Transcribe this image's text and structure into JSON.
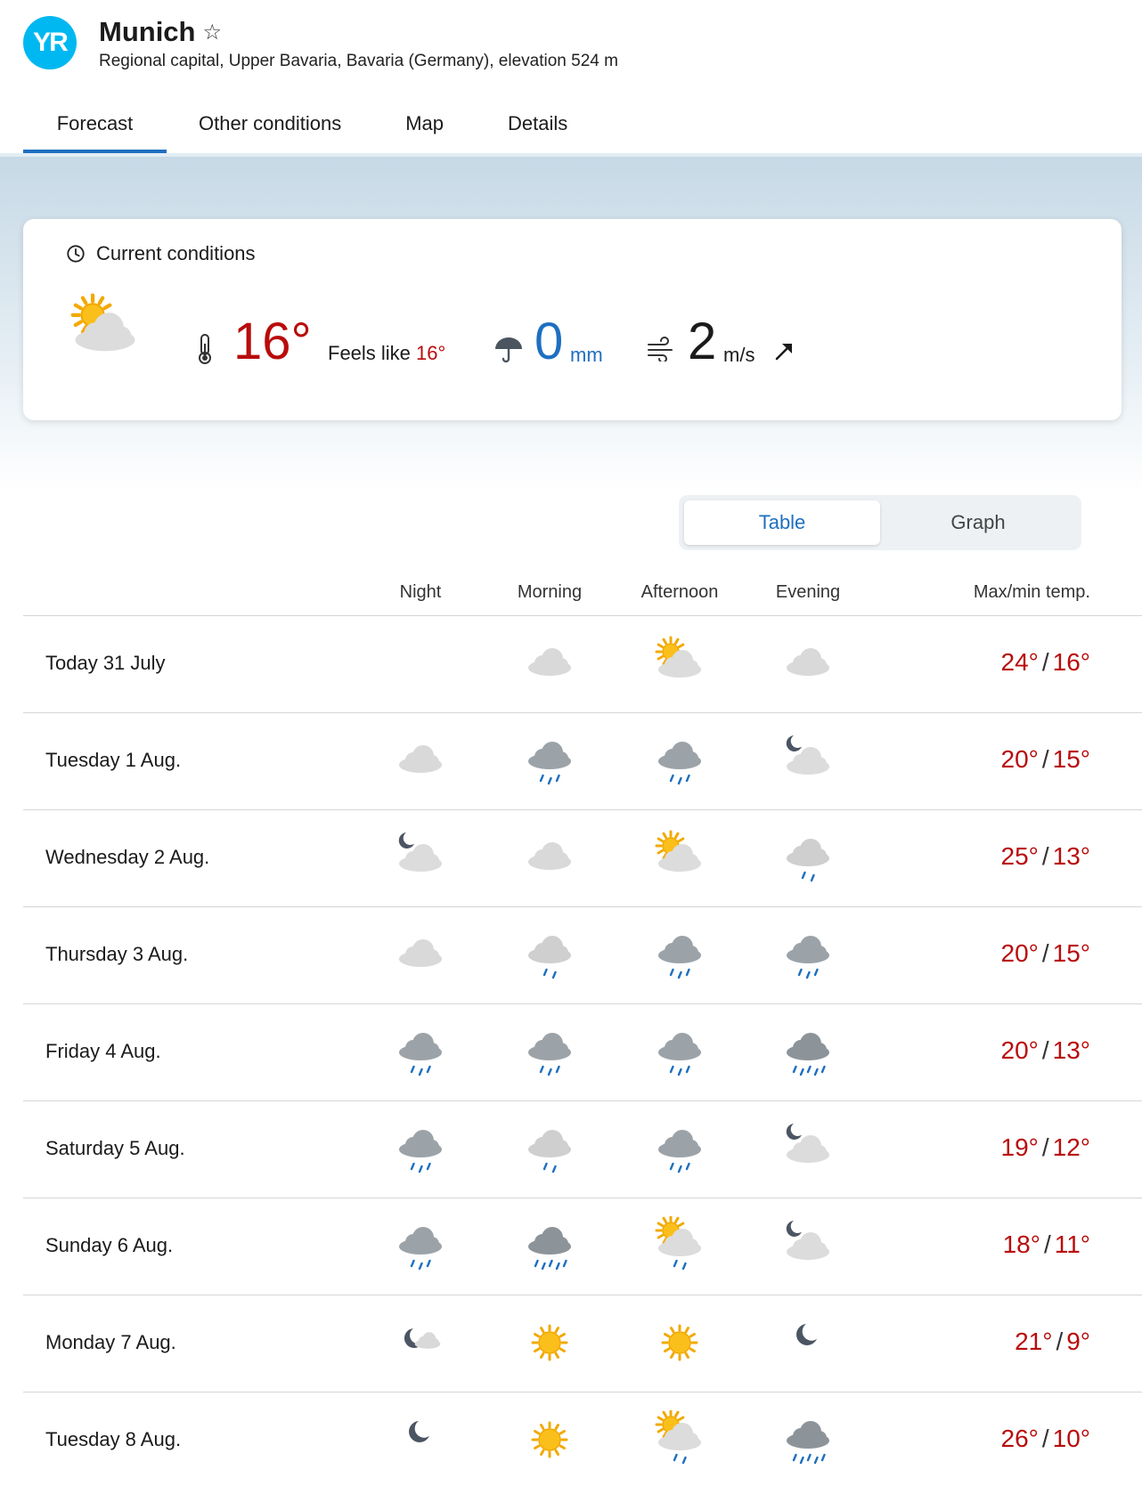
{
  "header": {
    "logo_text": "YR",
    "title": "Munich",
    "subtitle": "Regional capital, Upper Bavaria, Bavaria (Germany), elevation 524 m"
  },
  "tabs": [
    {
      "label": "Forecast",
      "active": true
    },
    {
      "label": "Other conditions",
      "active": false
    },
    {
      "label": "Map",
      "active": false
    },
    {
      "label": "Details",
      "active": false
    }
  ],
  "current": {
    "label": "Current conditions",
    "icon": "partly-cloudy-day",
    "temp": "16°",
    "feels_label": "Feels like",
    "feels_value": "16°",
    "precip_value": "0",
    "precip_unit": "mm",
    "wind_value": "2",
    "wind_unit": "m/s"
  },
  "view_toggle": {
    "table": "Table",
    "graph": "Graph",
    "selected": "Table"
  },
  "columns": {
    "night": "Night",
    "morning": "Morning",
    "afternoon": "Afternoon",
    "evening": "Evening",
    "maxmin": "Max/min temp."
  },
  "colors": {
    "accent": "#1e6fc0",
    "temp": "#b90c0c",
    "logo": "#00b8f1"
  },
  "days": [
    {
      "label": "Today 31 July",
      "night": "",
      "morning": "cloudy",
      "afternoon": "partly-cloudy-day",
      "evening": "cloudy",
      "max": "24°",
      "min": "16°"
    },
    {
      "label": "Tuesday 1 Aug.",
      "night": "cloudy",
      "morning": "rain",
      "afternoon": "rain",
      "evening": "partly-cloudy-night",
      "max": "20°",
      "min": "15°"
    },
    {
      "label": "Wednesday 2 Aug.",
      "night": "partly-cloudy-night",
      "morning": "cloudy",
      "afternoon": "partly-cloudy-day",
      "evening": "light-rain",
      "max": "25°",
      "min": "13°"
    },
    {
      "label": "Thursday 3 Aug.",
      "night": "cloudy",
      "morning": "light-rain",
      "afternoon": "rain",
      "evening": "rain",
      "max": "20°",
      "min": "15°"
    },
    {
      "label": "Friday 4 Aug.",
      "night": "rain",
      "morning": "rain",
      "afternoon": "rain",
      "evening": "heavy-rain",
      "max": "20°",
      "min": "13°"
    },
    {
      "label": "Saturday 5 Aug.",
      "night": "rain",
      "morning": "light-rain",
      "afternoon": "rain",
      "evening": "partly-cloudy-night",
      "max": "19°",
      "min": "12°"
    },
    {
      "label": "Sunday 6 Aug.",
      "night": "rain",
      "morning": "heavy-rain",
      "afternoon": "rain-showers-day",
      "evening": "partly-cloudy-night",
      "max": "18°",
      "min": "11°"
    },
    {
      "label": "Monday 7 Aug.",
      "night": "fair-night",
      "morning": "clear-sun",
      "afternoon": "clear-sun",
      "evening": "clear-night",
      "max": "21°",
      "min": "9°"
    },
    {
      "label": "Tuesday 8 Aug.",
      "night": "clear-night",
      "morning": "clear-sun",
      "afternoon": "rain-showers-day",
      "evening": "heavy-rain",
      "max": "26°",
      "min": "10°"
    }
  ]
}
